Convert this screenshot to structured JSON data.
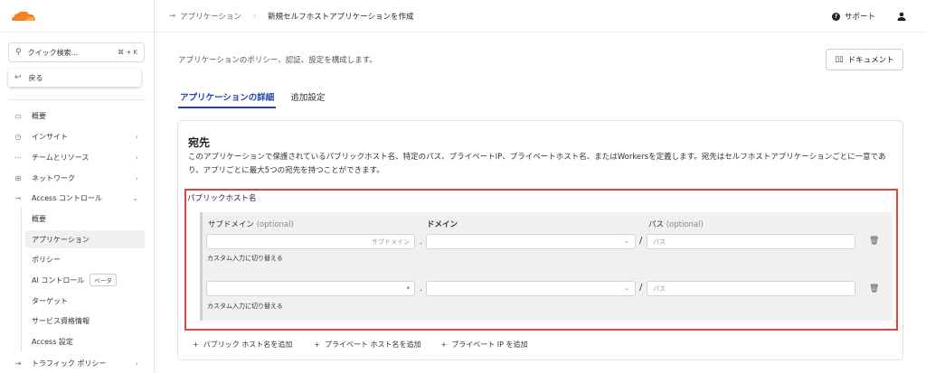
{
  "sidebar": {
    "search_label": "クイック検索...",
    "search_shortcut": "⌘ + K",
    "back_label": "戻る",
    "items": [
      {
        "label": "概要",
        "icon": "overview-icon"
      },
      {
        "label": "インサイト",
        "icon": "insights-icon"
      },
      {
        "label": "チームとリソース",
        "icon": "teams-icon"
      },
      {
        "label": "ネットワーク",
        "icon": "network-icon"
      },
      {
        "label": "Access コントロール",
        "icon": "access-icon"
      }
    ],
    "sub_items": [
      {
        "label": "概要"
      },
      {
        "label": "アプリケーション"
      },
      {
        "label": "ポリシー"
      },
      {
        "label": "AI コントロール",
        "badge": "ベータ"
      },
      {
        "label": "ターゲット"
      },
      {
        "label": "サービス資格情報"
      },
      {
        "label": "Access 設定"
      }
    ],
    "bottom_item": "トラフィック ポリシー"
  },
  "topbar": {
    "breadcrumb_parent": "アプリケーション",
    "breadcrumb_current": "新規セルフホストアプリケーションを作成",
    "support_label": "サポート"
  },
  "main": {
    "description": "アプリケーションのポリシー、認証、設定を構成します。",
    "doc_button": "ドキュメント",
    "tabs": [
      {
        "label": "アプリケーションの詳細",
        "active": true
      },
      {
        "label": "追加設定",
        "active": false
      }
    ],
    "card": {
      "title": "宛先",
      "description": "このアプリケーションで保護されているパブリックホスト名、特定のパス、プライベートIP、プライベートホスト名、またはWorkersを定義します。宛先はセルフホストアプリケーションごとに一意であり、アプリごとに最大5つの宛先を持つことができます。"
    },
    "public_hostname": {
      "label": "パブリックホスト名",
      "col_subdomain": "サブドメイン",
      "col_optional": "(optional)",
      "col_domain": "ドメイン",
      "col_path": "パス",
      "rows": [
        {
          "subdomain_placeholder": "サブドメイン",
          "path_placeholder": "パス",
          "switch_label": "カスタム入力に切り替える"
        },
        {
          "subdomain_value": "*",
          "path_placeholder": "パス",
          "switch_label": "カスタム入力に切り替える"
        }
      ]
    },
    "add_links": [
      "パブリック ホスト名を追加",
      "プライベート ホスト名を追加",
      "プライベート IP を追加"
    ]
  },
  "colors": {
    "accent": "#1f47a8",
    "highlight_border": "#e0443e",
    "logo_orange": "#f6821f"
  }
}
